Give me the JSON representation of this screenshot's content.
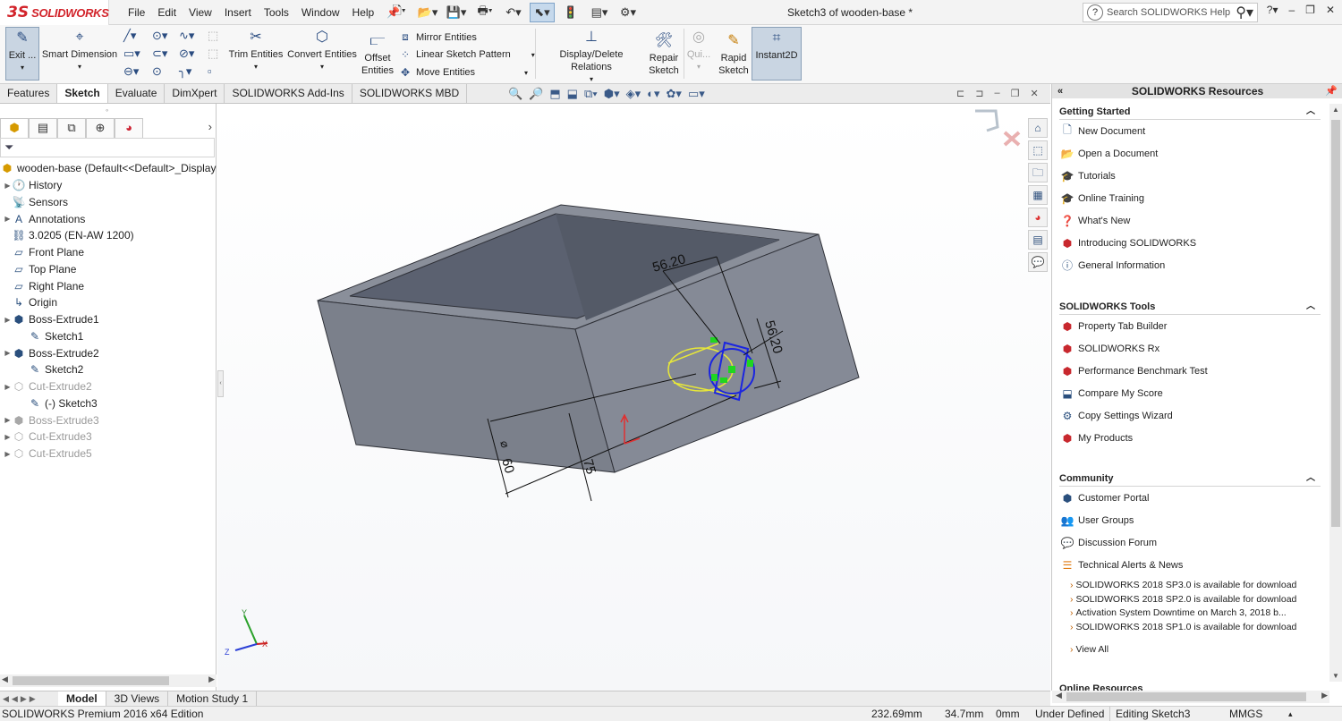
{
  "app": {
    "logo_ds": "3S",
    "logo_text": "SOLIDWORKS",
    "document_title": "Sketch3 of wooden-base *",
    "help_search_placeholder": "Search SOLIDWORKS Help"
  },
  "menu": [
    "File",
    "Edit",
    "View",
    "Insert",
    "Tools",
    "Window",
    "Help"
  ],
  "ribbon": {
    "exit_sketch": "Exit ...",
    "smart_dimension": "Smart Dimension",
    "trim_entities": "Trim Entities",
    "convert_entities": "Convert Entities",
    "offset_entities_1": "Offset",
    "offset_entities_2": "Entities",
    "mirror_entities": "Mirror Entities",
    "linear_sketch_pattern": "Linear Sketch Pattern",
    "move_entities": "Move Entities",
    "display_delete_relations": "Display/Delete Relations",
    "repair_sketch_1": "Repair",
    "repair_sketch_2": "Sketch",
    "quick_snaps": "Qui...",
    "rapid_sketch_1": "Rapid",
    "rapid_sketch_2": "Sketch",
    "instant2d": "Instant2D"
  },
  "tabs": [
    "Features",
    "Sketch",
    "Evaluate",
    "DimXpert",
    "SOLIDWORKS Add-Ins",
    "SOLIDWORKS MBD"
  ],
  "active_tab": "Sketch",
  "feature_tree": {
    "root": "wooden-base  (Default<<Default>_Display",
    "items": [
      {
        "label": "History",
        "level": 1,
        "icon": "history-icon",
        "expand": true,
        "dim": false
      },
      {
        "label": "Sensors",
        "level": 1,
        "icon": "sensor-icon",
        "expand": false,
        "dim": false
      },
      {
        "label": "Annotations",
        "level": 1,
        "icon": "annotations-icon",
        "expand": true,
        "dim": false
      },
      {
        "label": "3.0205 (EN-AW 1200)",
        "level": 1,
        "icon": "material-icon",
        "expand": false,
        "dim": false
      },
      {
        "label": "Front Plane",
        "level": 1,
        "icon": "plane-icon",
        "expand": false,
        "dim": false
      },
      {
        "label": "Top Plane",
        "level": 1,
        "icon": "plane-icon",
        "expand": false,
        "dim": false
      },
      {
        "label": "Right Plane",
        "level": 1,
        "icon": "plane-icon",
        "expand": false,
        "dim": false
      },
      {
        "label": "Origin",
        "level": 1,
        "icon": "origin-icon",
        "expand": false,
        "dim": false
      },
      {
        "label": "Boss-Extrude1",
        "level": 1,
        "icon": "extrude-icon",
        "expand": true,
        "dim": false
      },
      {
        "label": "Sketch1",
        "level": 2,
        "icon": "sketch-icon",
        "expand": false,
        "dim": false
      },
      {
        "label": "Boss-Extrude2",
        "level": 1,
        "icon": "extrude-icon",
        "expand": true,
        "dim": false
      },
      {
        "label": "Sketch2",
        "level": 2,
        "icon": "sketch-icon",
        "expand": false,
        "dim": false
      },
      {
        "label": "Cut-Extrude2",
        "level": 1,
        "icon": "cut-icon",
        "expand": true,
        "dim": true
      },
      {
        "label": "(-) Sketch3",
        "level": 2,
        "icon": "sketch-icon",
        "expand": false,
        "dim": false
      },
      {
        "label": "Boss-Extrude3",
        "level": 1,
        "icon": "extrude-icon",
        "expand": true,
        "dim": true
      },
      {
        "label": "Cut-Extrude3",
        "level": 1,
        "icon": "cut-icon",
        "expand": true,
        "dim": true
      },
      {
        "label": "Cut-Extrude5",
        "level": 1,
        "icon": "cut-icon",
        "expand": true,
        "dim": true
      }
    ]
  },
  "dimensions": {
    "top": "56.20",
    "right": "56.20",
    "diameter": "60",
    "depth": "75",
    "diameter_symbol": "⌀"
  },
  "triad": {
    "x": "X",
    "y": "Y",
    "z": "Z"
  },
  "resources": {
    "title": "SOLIDWORKS Resources",
    "sections": [
      {
        "title": "Getting Started",
        "items": [
          {
            "label": "New Document",
            "icon": "new-document-icon"
          },
          {
            "label": "Open a Document",
            "icon": "open-document-icon"
          },
          {
            "label": "Tutorials",
            "icon": "tutorials-icon"
          },
          {
            "label": "Online Training",
            "icon": "online-training-icon"
          },
          {
            "label": "What's New",
            "icon": "whats-new-icon"
          },
          {
            "label": "Introducing SOLIDWORKS",
            "icon": "introducing-icon"
          },
          {
            "label": "General Information",
            "icon": "info-icon"
          }
        ]
      },
      {
        "title": "SOLIDWORKS Tools",
        "items": [
          {
            "label": "Property Tab Builder",
            "icon": "property-tab-icon"
          },
          {
            "label": "SOLIDWORKS Rx",
            "icon": "rx-icon"
          },
          {
            "label": "Performance Benchmark Test",
            "icon": "benchmark-icon"
          },
          {
            "label": "Compare My Score",
            "icon": "compare-icon"
          },
          {
            "label": "Copy Settings Wizard",
            "icon": "copy-settings-icon"
          },
          {
            "label": "My Products",
            "icon": "products-icon"
          }
        ]
      },
      {
        "title": "Community",
        "items": [
          {
            "label": "Customer Portal",
            "icon": "portal-icon"
          },
          {
            "label": "User Groups",
            "icon": "user-groups-icon"
          },
          {
            "label": "Discussion Forum",
            "icon": "forum-icon"
          },
          {
            "label": "Technical Alerts & News",
            "icon": "rss-icon"
          }
        ]
      }
    ],
    "news": [
      "SOLIDWORKS 2018 SP3.0 is available for download",
      "SOLIDWORKS 2018 SP2.0 is available for download",
      "Activation System Downtime on March 3, 2018 b...",
      "SOLIDWORKS 2018 SP1.0 is available for download"
    ],
    "view_all": "View All",
    "next_section": "Online Resources"
  },
  "bottom_tabs": [
    "Model",
    "3D Views",
    "Motion Study 1"
  ],
  "active_bottom_tab": "Model",
  "status": {
    "edition": "SOLIDWORKS Premium 2016 x64 Edition",
    "x": "232.69mm",
    "y": "34.7mm",
    "z": "0mm",
    "definition": "Under Defined",
    "editing": "Editing Sketch3",
    "units": "MMGS"
  },
  "colors": {
    "brand_red": "#d2232a",
    "model_face_top": "#8a8f9a",
    "model_face_front": "#7b808b",
    "model_face_side": "#858a96",
    "sketch_blue": "#1b25e0",
    "preview_yellow": "#e8e838",
    "relation_green": "#1fd61f"
  }
}
